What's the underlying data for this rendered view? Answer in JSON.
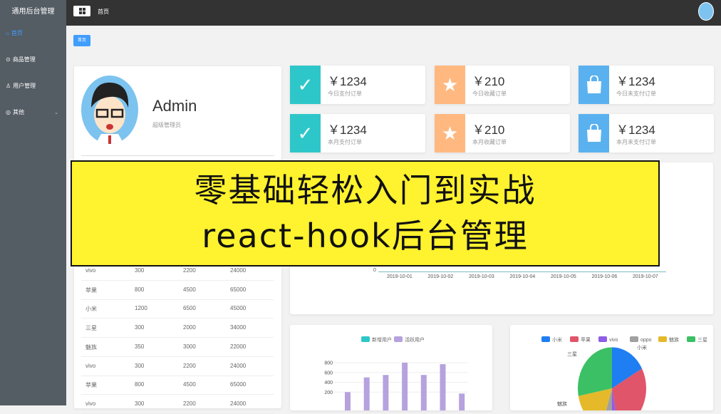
{
  "app_title": "通用后台管理",
  "sidebar": {
    "items": [
      {
        "label": "首页",
        "icon": "home-icon"
      },
      {
        "label": "商品管理",
        "icon": "play-circle-icon"
      },
      {
        "label": "用户管理",
        "icon": "user-icon"
      },
      {
        "label": "其他",
        "icon": "location-icon"
      }
    ]
  },
  "header": {
    "breadcrumb": "首页"
  },
  "tag": "首页",
  "profile": {
    "name": "Admin",
    "role": "超级管理员"
  },
  "table": {
    "rows": [
      [
        "vivo",
        "300",
        "2200",
        "24000"
      ],
      [
        "苹果",
        "800",
        "4500",
        "65000"
      ],
      [
        "小米",
        "1200",
        "6500",
        "45000"
      ],
      [
        "三星",
        "300",
        "2000",
        "34000"
      ],
      [
        "魅族",
        "350",
        "3000",
        "22000"
      ],
      [
        "vivo",
        "300",
        "2200",
        "24000"
      ],
      [
        "苹果",
        "800",
        "4500",
        "65000"
      ],
      [
        "vivo",
        "300",
        "2200",
        "24000"
      ]
    ]
  },
  "stats": [
    {
      "value": "￥1234",
      "label": "今日支付订单",
      "icon": "check-circle-icon",
      "color": "#2ec7c9"
    },
    {
      "value": "￥210",
      "label": "今日收藏订单",
      "icon": "star-icon",
      "color": "#ffb980"
    },
    {
      "value": "￥1234",
      "label": "今日未支付订单",
      "icon": "shopping-bag-icon",
      "color": "#5ab1ef"
    },
    {
      "value": "￥1234",
      "label": "本月支付订单",
      "icon": "check-circle-icon",
      "color": "#2ec7c9"
    },
    {
      "value": "￥210",
      "label": "本月收藏订单",
      "icon": "star-icon",
      "color": "#ffb980"
    },
    {
      "value": "￥1234",
      "label": "本月未支付订单",
      "icon": "shopping-bag-icon",
      "color": "#5ab1ef"
    }
  ],
  "banner": {
    "line1": "零基础轻松入门到实战",
    "line2": "react-hook后台管理"
  },
  "chart_data": [
    {
      "type": "line",
      "x": [
        "2019-10-01",
        "2019-10-02",
        "2019-10-03",
        "2019-10-04",
        "2019-10-05",
        "2019-10-06",
        "2019-10-07"
      ],
      "y_ticks": [
        "0"
      ]
    },
    {
      "type": "bar",
      "legend": [
        "新增用户",
        "活跃用户"
      ],
      "colors": [
        "#2ec7c9",
        "#b6a2de"
      ],
      "y_ticks": [
        "800",
        "600",
        "400",
        "200"
      ],
      "ylim": [
        0,
        800
      ],
      "series": [
        {
          "name": "活跃用户",
          "values": [
            200,
            500,
            550,
            800,
            550,
            770,
            170
          ]
        }
      ]
    },
    {
      "type": "pie",
      "legend": [
        "小米",
        "苹果",
        "vivo",
        "oppo",
        "魅族",
        "三星"
      ],
      "colors": [
        "#1e7ef2",
        "#e0556a",
        "#8f5de6",
        "#a0a0a0",
        "#e5b92a",
        "#3cc065"
      ],
      "values": [
        17,
        30,
        3,
        5,
        17,
        28
      ],
      "labels_shown": [
        "小米",
        "三星",
        "魅族"
      ]
    }
  ]
}
